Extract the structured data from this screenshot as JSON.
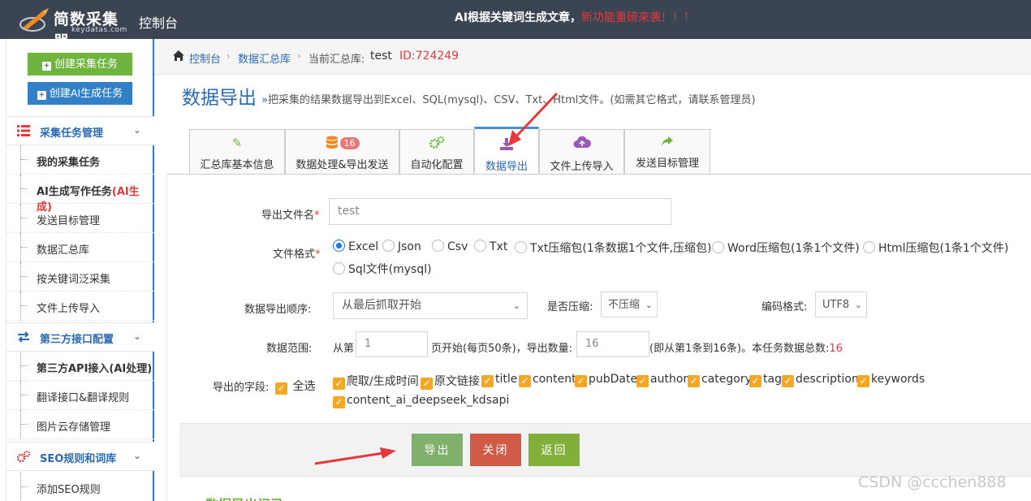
{
  "header": {
    "logo_name": "简数采集器",
    "logo_domain": "keydatas.com",
    "console_title": "控制台",
    "announcement": "AI根据关键词生成文章，",
    "announcement_hot": "新功能重磅来袭！！！"
  },
  "sidebar": {
    "create_task": "创建采集任务",
    "create_ai_task": "创建AI生成任务",
    "groups": [
      {
        "label": "采集任务管理",
        "icon": "list-icon",
        "items": [
          {
            "label": "我的采集任务"
          },
          {
            "label": "AI生成写作任务",
            "suffix": "(AI生成)"
          },
          {
            "label": "发送目标管理"
          },
          {
            "label": "数据汇总库"
          },
          {
            "label": "按关键词泛采集"
          },
          {
            "label": "文件上传导入"
          }
        ]
      },
      {
        "label": "第三方接口配置",
        "icon": "exchange-icon",
        "items": [
          {
            "label": "第三方API接入(AI处理)"
          },
          {
            "label": "翻译接口&翻译规则"
          },
          {
            "label": "图片云存储管理"
          }
        ]
      },
      {
        "label": "SEO规则和词库",
        "icon": "gears-icon",
        "items": [
          {
            "label": "添加SEO规则"
          }
        ]
      }
    ]
  },
  "breadcrumb": {
    "home": "控制台",
    "library": "数据汇总库",
    "current_label": "当前汇总库:",
    "current_name": "test",
    "current_id": "ID:724249"
  },
  "page": {
    "title": "数据导出",
    "description_arrow": "»",
    "description": "把采集的结果数据导出到Excel、SQL(mysql)、CSV、Txt、Html文件。(如需其它格式，请联系管理员)"
  },
  "tabs": [
    {
      "label": "汇总库基本信息",
      "icon": "edit-icon"
    },
    {
      "label": "数据处理&导出发送",
      "icon": "database-icon",
      "badge": "16"
    },
    {
      "label": "自动化配置",
      "icon": "gears-icon"
    },
    {
      "label": "数据导出",
      "icon": "download-icon",
      "active": true
    },
    {
      "label": "文件上传导入",
      "icon": "cloud-upload-icon"
    },
    {
      "label": "发送目标管理",
      "icon": "share-icon"
    }
  ],
  "form": {
    "filename_label": "导出文件名",
    "filename_value": "test",
    "format_label": "文件格式",
    "formats": [
      "Excel",
      "Json",
      "Csv",
      "Txt",
      "Txt压缩包(1条数据1个文件,压缩包)",
      "Word压缩包(1条1个文件)",
      "Html压缩包(1条1个文件)",
      "Sql文件(mysql)"
    ],
    "order_label": "数据导出顺序:",
    "order_value": "从最后抓取开始",
    "compress_label": "是否压缩:",
    "compress_value": "不压缩",
    "encoding_label": "编码格式:",
    "encoding_value": "UTF8",
    "range_label": "数据范围:",
    "range_from": "从第",
    "range_start": "1",
    "range_mid": "页开始(每页50条)，导出数量:",
    "range_count": "16",
    "range_note": "(即从第1条到16条)。本任务数据总数:",
    "range_total": "16",
    "fields_label": "导出的字段:",
    "select_all": "全选",
    "fields": [
      "爬取/生成时间",
      "原文链接",
      "title",
      "content",
      "pubDate",
      "author",
      "category",
      "tag",
      "description",
      "keywords",
      "content_ai_deepseek_kdsapi"
    ]
  },
  "actions": {
    "export": "导出",
    "close": "关闭",
    "back": "返回"
  },
  "records_heading": "数据导出记录",
  "watermark": "CSDN @ccchen888",
  "colors": {
    "header_bg": "#3a4452",
    "primary_blue": "#2a6ab3",
    "green": "#6fb43f",
    "red": "#e4393c",
    "checkbox": "#f5a623"
  }
}
